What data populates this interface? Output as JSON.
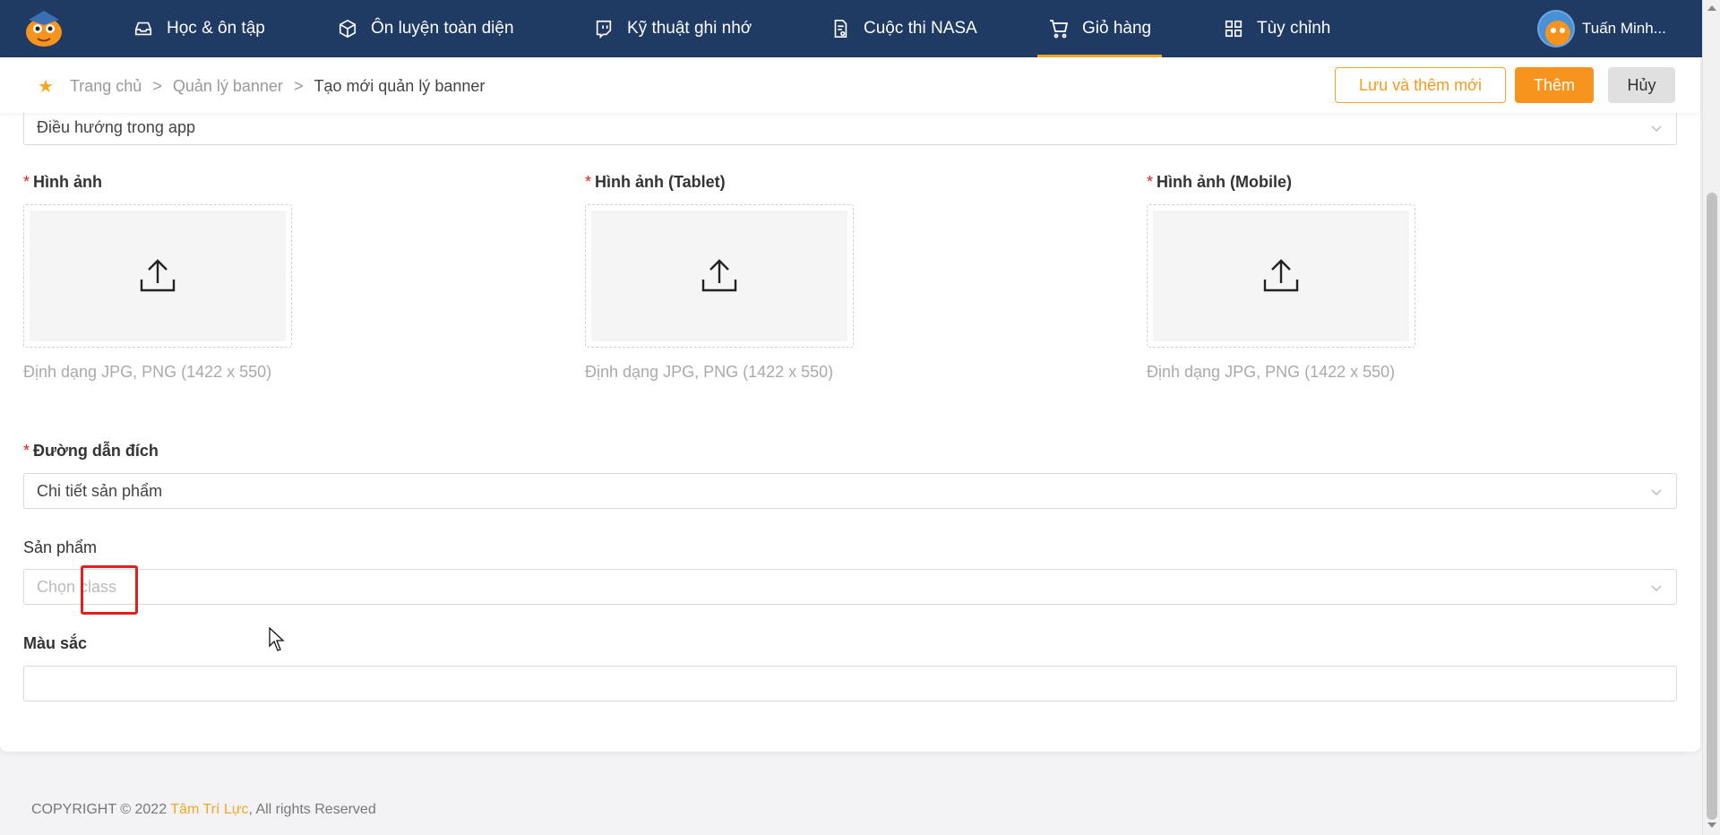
{
  "nav": {
    "items": [
      {
        "label": "Học & ôn tập",
        "icon": "inbox-icon"
      },
      {
        "label": "Ôn luyện toàn diện",
        "icon": "cube-icon"
      },
      {
        "label": "Kỹ thuật ghi nhớ",
        "icon": "twitch-icon"
      },
      {
        "label": "Cuộc thi NASA",
        "icon": "audit-icon"
      },
      {
        "label": "Giỏ hàng",
        "icon": "cart-icon",
        "active": true
      },
      {
        "label": "Tùy chỉnh",
        "icon": "grid-icon"
      }
    ],
    "user_name": "Tuấn Minh..."
  },
  "breadcrumb": {
    "home": "Trang chủ",
    "section": "Quản lý banner",
    "current": "Tạo mới quản lý banner",
    "separator": ">"
  },
  "actions": {
    "save_add_label": "Lưu và thêm mới",
    "add_label": "Thêm",
    "cancel_label": "Hủy"
  },
  "form": {
    "nav_type_value": "Điều hướng trong app",
    "image_label": "Hình ảnh",
    "image_tablet_label": "Hình ảnh (Tablet)",
    "image_mobile_label": "Hình ảnh (Mobile)",
    "image_hint": "Định dạng JPG, PNG (1422 x 550)",
    "required_mark": "*",
    "target_label": "Đường dẫn đích",
    "target_value": "Chi tiết sản phẩm",
    "product_label": "Sản phẩm",
    "product_placeholder": "Chọn class",
    "color_label": "Màu sắc",
    "color_value": ""
  },
  "footer": {
    "prefix": "COPYRIGHT © 2022 ",
    "brand": "Tâm Trí Lực",
    "suffix": ", All rights Reserved"
  },
  "colors": {
    "nav_bg": "#1f3a63",
    "accent": "#f7941d",
    "required": "#e02020"
  }
}
